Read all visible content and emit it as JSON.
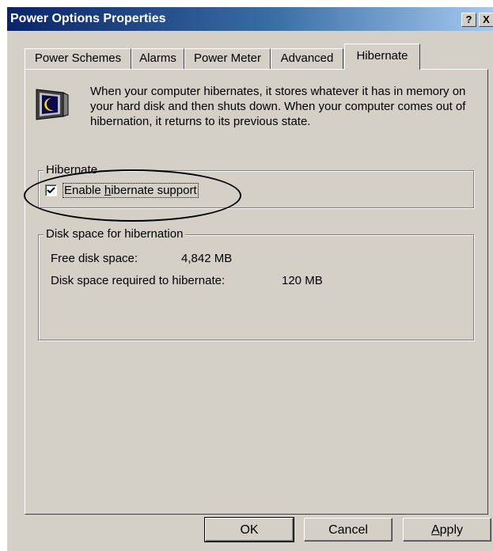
{
  "window": {
    "title": "Power Options Properties"
  },
  "caption_buttons": {
    "help": "?",
    "close": "X"
  },
  "tabs": [
    {
      "label": "Power Schemes"
    },
    {
      "label": "Alarms"
    },
    {
      "label": "Power Meter"
    },
    {
      "label": "Advanced"
    },
    {
      "label": "Hibernate",
      "active": true
    }
  ],
  "hibernate_tab": {
    "icon": "monitor-moon-icon",
    "description": "When your computer hibernates, it stores whatever it has in memory on your hard disk and then shuts down. When your computer comes out of hibernation, it returns to its previous state.",
    "hibernate_group": {
      "title": "Hibernate",
      "checkbox_prefix": "Enable ",
      "checkbox_access": "h",
      "checkbox_suffix": "ibernate support",
      "checked": true
    },
    "disk_group": {
      "title": "Disk space for hibernation",
      "free_label": "Free disk space:",
      "free_value": "4,842 MB",
      "required_label": "Disk space required to hibernate:",
      "required_value": "120 MB"
    }
  },
  "buttons": {
    "ok": "OK",
    "cancel": "Cancel",
    "apply_access": "A",
    "apply_rest": "pply"
  },
  "colors": {
    "face": "#d4d0c8",
    "title_start": "#0a246a",
    "title_end": "#a6caf0",
    "annotation": "#000000"
  }
}
